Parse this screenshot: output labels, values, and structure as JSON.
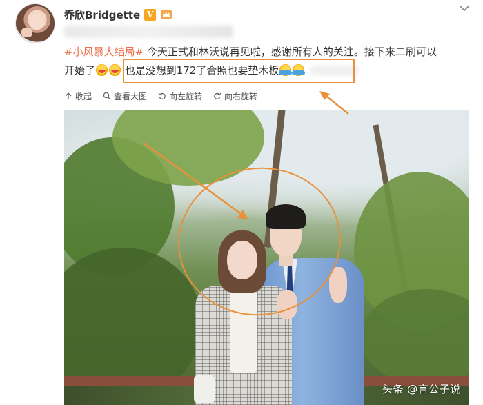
{
  "post": {
    "username": "乔欣Bridgette",
    "verified_badge": "V",
    "hashtag": "#小风暴大结局#",
    "text_line1": " 今天正式和林沃说再见啦，感谢所有人的关注。接下来二刷可以",
    "text_line2_prefix": "开始了",
    "text_highlight": "也是没想到172了合照也要垫木板"
  },
  "toolbar": {
    "collapse_label": "收起",
    "view_large_label": "查看大图",
    "rotate_left_label": "向左旋转",
    "rotate_right_label": "向右旋转"
  },
  "watermark": "头条 @言公子说",
  "colors": {
    "hashtag": "#eb7350",
    "annotation": "#e8913a",
    "badge": "#f5a623"
  },
  "icons": [
    "crown-icon",
    "more-chevron-icon",
    "collapse-arrow-icon",
    "magnify-icon",
    "rotate-left-icon",
    "rotate-right-icon"
  ]
}
